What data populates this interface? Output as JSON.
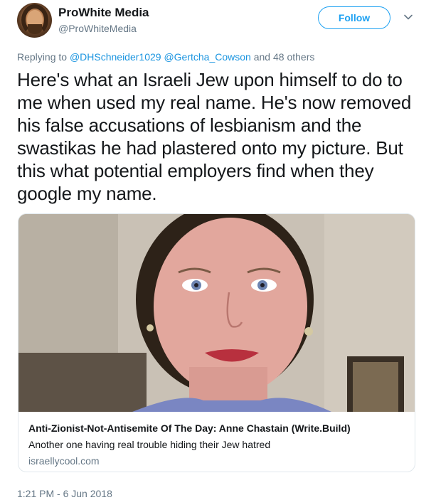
{
  "author": {
    "display_name": "ProWhite Media",
    "handle": "@ProWhiteMedia"
  },
  "follow_button": {
    "label": "Follow"
  },
  "reply": {
    "prefix": "Replying to ",
    "mention_1": "@DHSchneider1029",
    "mention_2": "@Gertcha_Cowson",
    "suffix": " and 48 others"
  },
  "tweet": {
    "text": "Here's what an Israeli Jew upon himself to do to me when used my real name. He's now removed his false accusations of lesbianism and the swastikas he had plastered onto my picture. But this what potential employers find when they google my name."
  },
  "card": {
    "title": "Anti-Zionist-Not-Antisemite Of The Day: Anne Chastain (Write.Build)",
    "description": "Another one having real trouble hiding their Jew hatred",
    "domain": "israellycool.com"
  },
  "timestamp": "1:21 PM - 6 Jun 2018",
  "colors": {
    "accent": "#1da1f2",
    "mention": "#1b95e0",
    "secondary_text": "#657786",
    "border": "#e1e8ed"
  },
  "icons": {
    "more_options": "chevron-down-icon"
  }
}
